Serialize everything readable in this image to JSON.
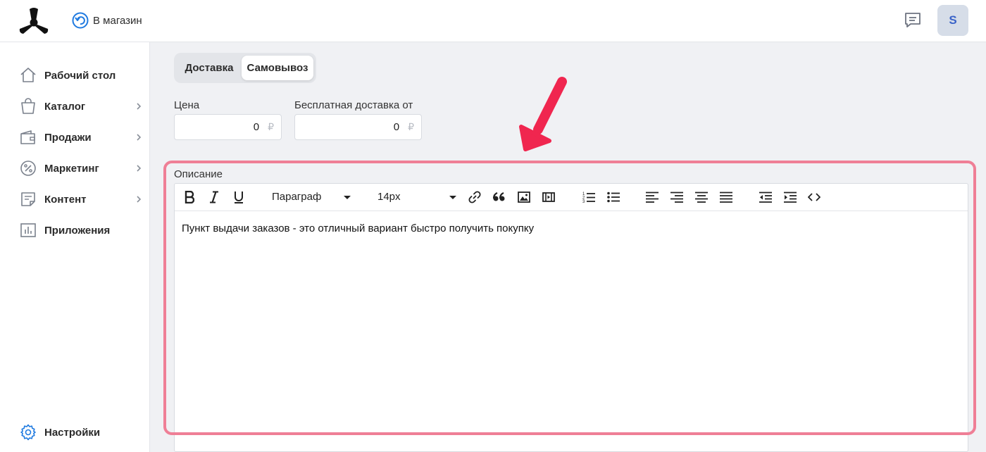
{
  "header": {
    "back_label": "В магазин",
    "avatar_letter": "S"
  },
  "sidebar": {
    "items": [
      {
        "label": "Рабочий стол",
        "icon": "home-icon",
        "has_submenu": false
      },
      {
        "label": "Каталог",
        "icon": "shopping-bag-icon",
        "has_submenu": true
      },
      {
        "label": "Продажи",
        "icon": "wallet-icon",
        "has_submenu": true
      },
      {
        "label": "Маркетинг",
        "icon": "percent-icon",
        "has_submenu": true
      },
      {
        "label": "Контент",
        "icon": "document-icon",
        "has_submenu": true
      },
      {
        "label": "Приложения",
        "icon": "bar-chart-icon",
        "has_submenu": false
      }
    ],
    "settings_label": "Настройки"
  },
  "tabs": {
    "delivery": "Доставка",
    "pickup": "Самовывоз",
    "active": "pickup"
  },
  "price": {
    "label": "Цена",
    "value": "0",
    "currency": "₽"
  },
  "free_delivery": {
    "label": "Бесплатная доставка от",
    "value": "0",
    "currency": "₽"
  },
  "description": {
    "label": "Описание",
    "format_select": "Параграф",
    "size_select": "14px",
    "content": "Пункт выдачи заказов - это отличный вариант быстро получить покупку"
  },
  "colors": {
    "accent": "#1f7ae0",
    "highlight": "#ef7f96",
    "arrow": "#f0264f"
  }
}
